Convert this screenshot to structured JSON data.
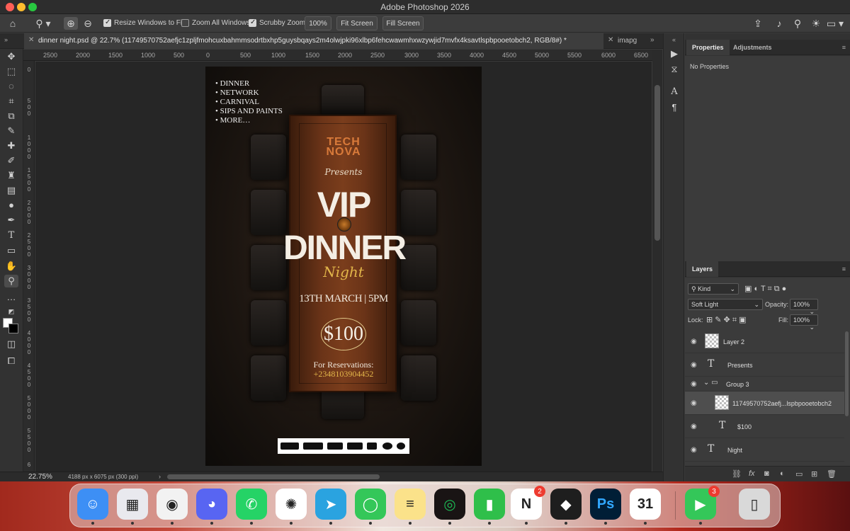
{
  "window": {
    "title": "Adobe Photoshop 2026"
  },
  "options_bar": {
    "resize_windows": {
      "label": "Resize Windows to Fit",
      "checked": true
    },
    "zoom_all": {
      "label": "Zoom All Windows",
      "checked": false
    },
    "scrubby_zoom": {
      "label": "Scrubby Zoom",
      "checked": true
    },
    "zoom_percent": "100%",
    "fit_screen": "Fit Screen",
    "fill_screen": "Fill Screen"
  },
  "tabs": {
    "active": "dinner night.psd @ 22.7% (11749570752aefjc1zpljfmohcuxbahmmsodrtbxhp5guysbqays2m4olwjpki96xlbp6fehcwawmhxwzywjid7mvfx4ksavtlspbpooetobch2, RGB/8#) *",
    "inactive": "imapg"
  },
  "ruler": {
    "h_ticks": [
      "2500",
      "2000",
      "1500",
      "1000",
      "500",
      "0",
      "500",
      "1000",
      "1500",
      "2000",
      "2500",
      "3000",
      "3500",
      "4000",
      "4500",
      "5000",
      "5500",
      "6000",
      "6500"
    ],
    "v_ticks": [
      "0",
      "500",
      "1000",
      "1500",
      "2000",
      "2500",
      "3000",
      "3500",
      "4000",
      "4500",
      "5000",
      "5500",
      "6"
    ]
  },
  "poster": {
    "list": [
      "• DINNER",
      "• NETWORK",
      "• CARNIVAL",
      "• SIPS AND PAINTS",
      "• MORE…"
    ],
    "brand_line1": "TECH",
    "brand_line2": "NOVA",
    "presents": "Presents",
    "vip": "VIP",
    "dinner": "DINNER",
    "night": "Night",
    "date": "13TH MARCH | 5PM",
    "price": "$100",
    "reservations_label": "For Reservations:",
    "phone": "+2348103904452"
  },
  "status": {
    "zoom": "22.75%",
    "doc_info": "4188 px x 6075 px (300 ppi)"
  },
  "properties_panel": {
    "tab_properties": "Properties",
    "tab_adjustments": "Adjustments",
    "empty_text": "No Properties"
  },
  "layers_panel": {
    "title": "Layers",
    "filter_kind": "Kind",
    "blend_mode": "Soft Light",
    "opacity_label": "Opacity:",
    "opacity_value": "100%",
    "lock_label": "Lock:",
    "fill_label": "Fill:",
    "fill_value": "100%",
    "layers": [
      {
        "name": "Layer 2",
        "kind": "pixel",
        "indent": 0,
        "selected": false
      },
      {
        "name": "Presents",
        "kind": "text",
        "indent": 0,
        "selected": false
      },
      {
        "name": "Group 3",
        "kind": "group",
        "indent": 0,
        "selected": false
      },
      {
        "name": "11749570752aefj...lspbpooetobch2",
        "kind": "pixel",
        "indent": 1,
        "selected": true
      },
      {
        "name": "$100",
        "kind": "text",
        "indent": 1,
        "selected": false
      },
      {
        "name": "Night",
        "kind": "text",
        "indent": 0,
        "selected": false
      }
    ]
  },
  "dock": {
    "apps": [
      {
        "name": "finder",
        "color": "#3d8ff5",
        "glyph": "☺",
        "badge": ""
      },
      {
        "name": "launchpad",
        "color": "#e9e9ee",
        "glyph": "▦",
        "badge": ""
      },
      {
        "name": "chrome",
        "color": "#f2f2f2",
        "glyph": "◉",
        "badge": ""
      },
      {
        "name": "discord",
        "color": "#5865f2",
        "glyph": "◕",
        "badge": ""
      },
      {
        "name": "whatsapp",
        "color": "#25d366",
        "glyph": "✆",
        "badge": ""
      },
      {
        "name": "chatgpt",
        "color": "#ffffff",
        "glyph": "✺",
        "badge": ""
      },
      {
        "name": "telegram",
        "color": "#2aa3e0",
        "glyph": "➤",
        "badge": ""
      },
      {
        "name": "messages",
        "color": "#34c759",
        "glyph": "◯",
        "badge": ""
      },
      {
        "name": "notes",
        "color": "#fbe28a",
        "glyph": "≡",
        "badge": ""
      },
      {
        "name": "spotify",
        "color": "#191414",
        "glyph": "◎",
        "badge": ""
      },
      {
        "name": "numbers",
        "color": "#2fbf4a",
        "glyph": "▮",
        "badge": ""
      },
      {
        "name": "notion",
        "color": "#ffffff",
        "glyph": "N",
        "badge": "2"
      },
      {
        "name": "figma",
        "color": "#1e1e1e",
        "glyph": "◆",
        "badge": ""
      },
      {
        "name": "photoshop",
        "color": "#001e36",
        "glyph": "Ps",
        "badge": ""
      },
      {
        "name": "calendar",
        "color": "#ffffff",
        "glyph": "31",
        "badge": ""
      },
      {
        "name": "facetime",
        "color": "#34c759",
        "glyph": "▶",
        "badge": "3"
      },
      {
        "name": "trash",
        "color": "#d9d9d9",
        "glyph": "▯",
        "badge": ""
      }
    ]
  }
}
